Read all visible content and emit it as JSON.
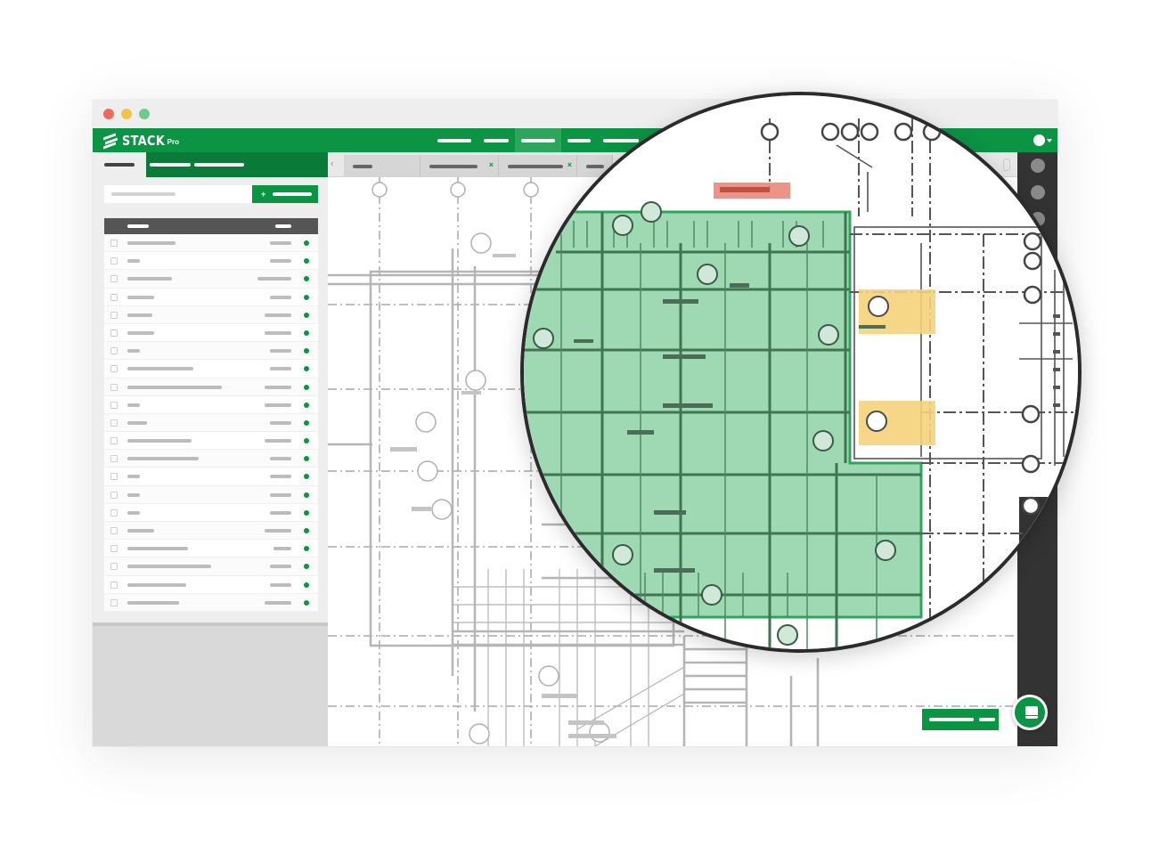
{
  "window": {
    "traffic_lights": {
      "close": "#ec6b5e",
      "minimize": "#f3c24c",
      "zoom": "#6fc98b"
    }
  },
  "app": {
    "brand_name": "STACK",
    "brand_tier": "Pro",
    "brand_color": "#0b9444"
  },
  "colors": {
    "takeoff_area": "#9fd9b3",
    "highlight_yellow": "#f5d27a",
    "highlight_red": "#e88a7a",
    "plan_line": "#9a9a9a",
    "sidebar_bg": "#eeeeee",
    "rail_bg": "#333333"
  },
  "sidebar": {
    "add_button_icon": "+",
    "row_count": 21
  },
  "icons": {
    "collapse": "‹",
    "close_tab": "×",
    "fab": "book-icon"
  }
}
